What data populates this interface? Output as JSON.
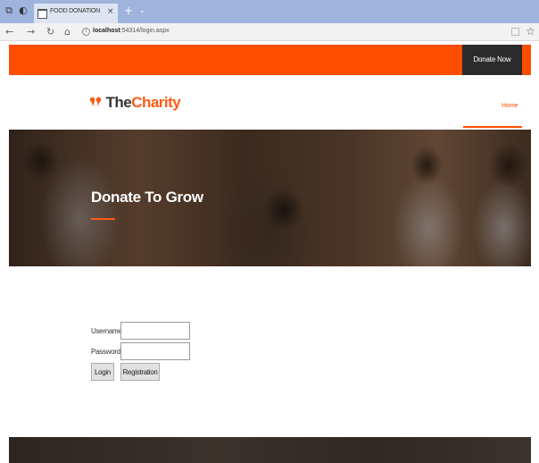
{
  "browser": {
    "tab_title": "FOOD DONATION",
    "tab_close": "×",
    "new_tab": "+",
    "tab_menu": "⌄",
    "url_host": "localhost",
    "url_rest": ":54314/login.aspx"
  },
  "topbar": {
    "accent_color": "#ff4e00",
    "donate_label": "Donate Now"
  },
  "header": {
    "logo_part1": "The",
    "logo_part2": "Charity",
    "nav_home": "Home"
  },
  "hero": {
    "title": "Donate To Grow"
  },
  "login": {
    "username_label": "Username",
    "password_label": "Password",
    "username_value": "",
    "password_value": "",
    "login_button": "Login",
    "registration_button": "Registration"
  }
}
